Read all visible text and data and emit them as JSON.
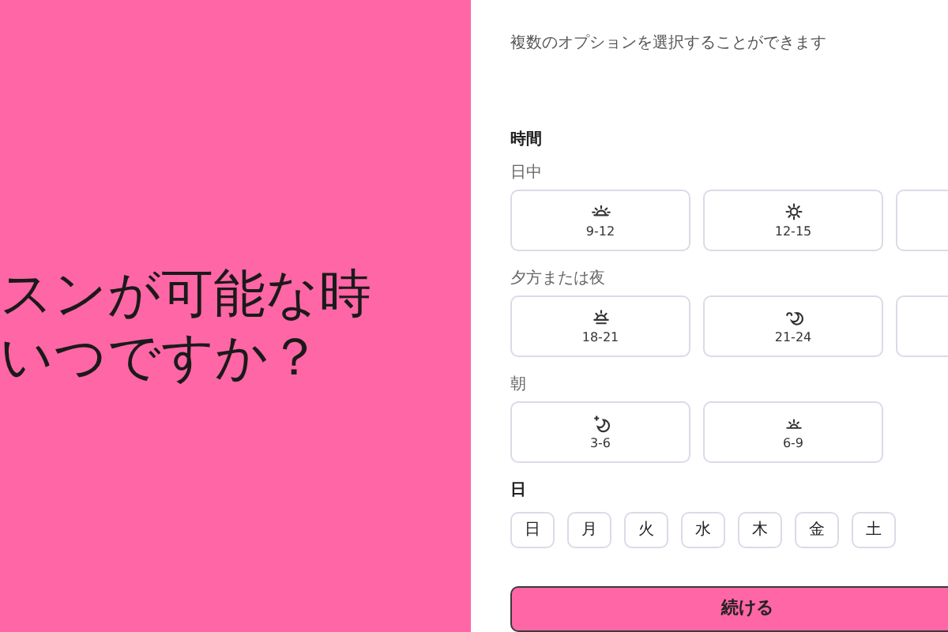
{
  "hero": {
    "lines": [
      "スンが可能な時",
      "いつですか？"
    ]
  },
  "subtitle": "複数のオプションを選択することができます",
  "time_section": {
    "title": "時間",
    "groups": [
      {
        "label": "日中",
        "options": [
          {
            "kind": "sunrise",
            "label": "9-12",
            "selected": false
          },
          {
            "kind": "sun",
            "label": "12-15",
            "selected": false
          },
          {
            "kind": "cut",
            "selected": false
          }
        ]
      },
      {
        "label": "夕方または夜",
        "options": [
          {
            "kind": "sunset",
            "label": "18-21",
            "selected": false
          },
          {
            "kind": "moon",
            "label": "21-24",
            "selected": false
          },
          {
            "kind": "cut",
            "selected": false
          }
        ]
      },
      {
        "label": "朝",
        "options": [
          {
            "kind": "night",
            "label": "3-6",
            "selected": false
          },
          {
            "kind": "dawn",
            "label": "6-9",
            "selected": false
          }
        ]
      }
    ]
  },
  "day_section": {
    "title": "日",
    "days": [
      {
        "label": "日",
        "selected": false
      },
      {
        "label": "月",
        "selected": false
      },
      {
        "label": "火",
        "selected": false
      },
      {
        "label": "水",
        "selected": false
      },
      {
        "label": "木",
        "selected": false
      },
      {
        "label": "金",
        "selected": false
      },
      {
        "label": "土",
        "selected": false
      }
    ]
  },
  "continue_button": "続ける"
}
